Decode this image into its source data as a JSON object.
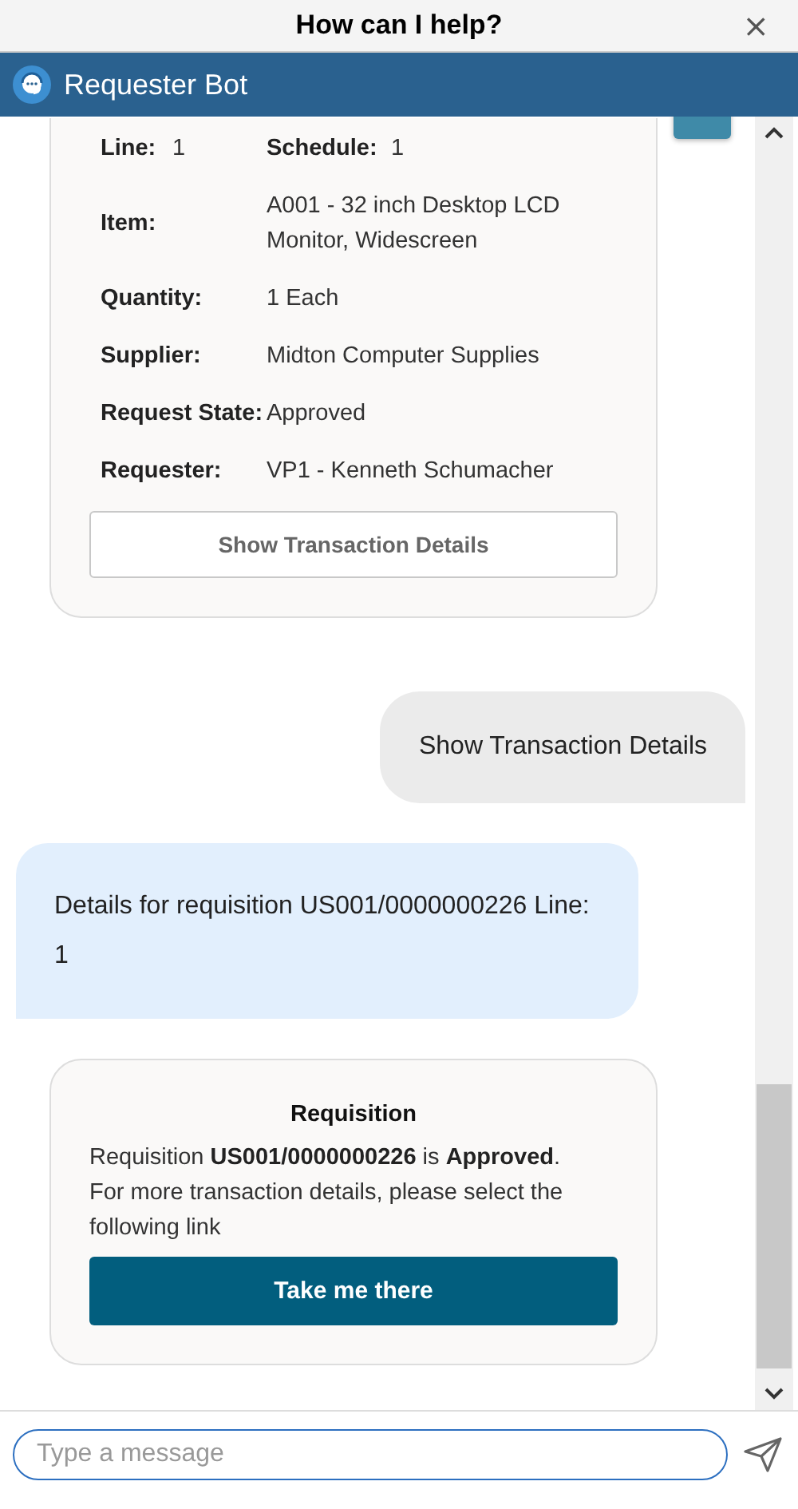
{
  "dialog": {
    "title": "How can I help?",
    "close": "×"
  },
  "bot": {
    "name": "Requester Bot"
  },
  "messages": [
    {
      "kind": "details_card",
      "rows": [
        [
          {
            "label": "Line:",
            "value": "1"
          },
          {
            "label": "Schedule:",
            "value": "1"
          }
        ],
        [
          {
            "label": "Item:",
            "value": "A001 - 32 inch Desktop LCD Monitor, Widescreen"
          }
        ],
        [
          {
            "label": "Quantity:",
            "value": "1 Each"
          }
        ],
        [
          {
            "label": "Supplier:",
            "value": "Midton Computer Supplies"
          }
        ],
        [
          {
            "label": "Request State:",
            "value": "Approved"
          }
        ],
        [
          {
            "label": "Requester:",
            "value": "VP1 - Kenneth Schumacher"
          }
        ]
      ],
      "action": "Show Transaction Details"
    },
    {
      "kind": "user",
      "text": "Show Transaction Details"
    },
    {
      "kind": "bot",
      "text": "Details for requisition US001/0000000226 Line: 1"
    },
    {
      "kind": "link_card",
      "title": "Requisition",
      "summary": "Requisition **US001/0000000226** is **Approved**.",
      "note": "For more transaction details, please select the following link",
      "button": "Take me there"
    }
  ],
  "composer": {
    "placeholder": "Type a message"
  }
}
